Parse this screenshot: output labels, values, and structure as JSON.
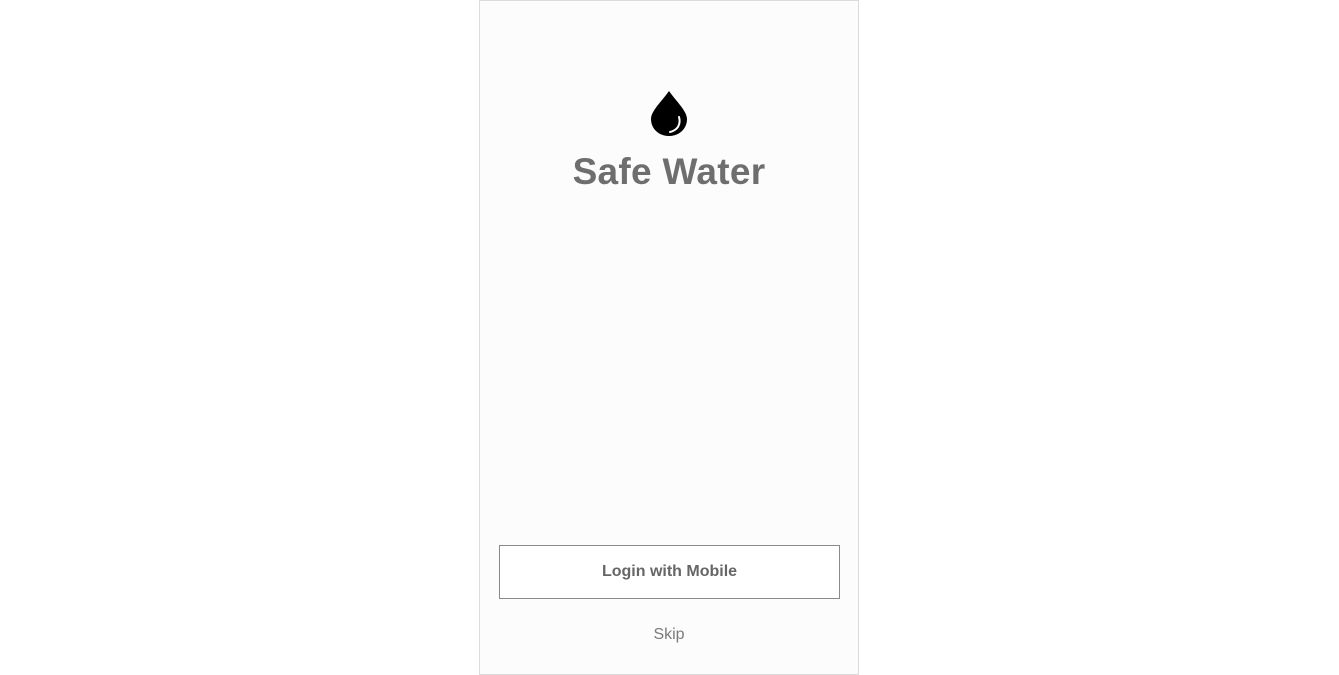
{
  "app": {
    "title": "Safe Water",
    "logo_icon": "water-drop-icon"
  },
  "actions": {
    "login_label": "Login with Mobile",
    "skip_label": "Skip"
  },
  "colors": {
    "title": "#6e6e6e",
    "button_border": "#8a8a8a",
    "button_text": "#666666",
    "icon": "#000000"
  }
}
